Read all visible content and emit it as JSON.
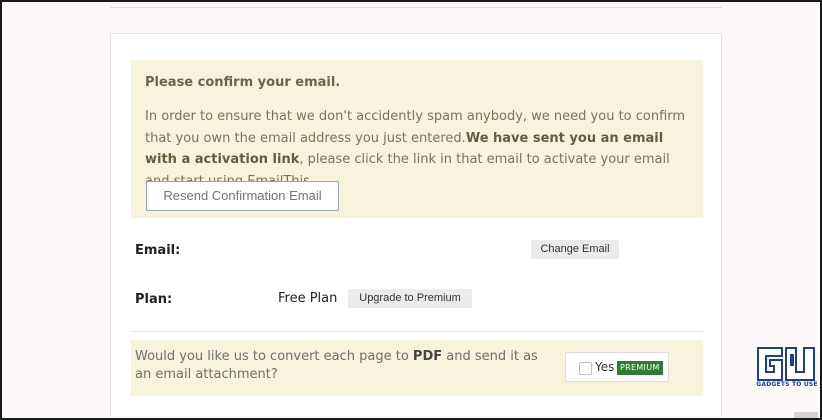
{
  "notice": {
    "title": "Please confirm your email.",
    "body_start": "In order to ensure that we don't accidently spam anybody, we need you to confirm that you own the email address you just entered.",
    "body_bold": "We have sent you an email with a activation link",
    "body_end": ", please click the link in that email to activate your email and start using EmailThis.",
    "resend_label": "Resend Confirmation Email"
  },
  "email": {
    "label": "Email:",
    "value": "",
    "change_label": "Change Email"
  },
  "plan": {
    "label": "Plan:",
    "value": "Free Plan",
    "upgrade_label": "Upgrade to Premium"
  },
  "pdf_option": {
    "text_start": "Would you like us to convert each page to ",
    "text_bold": "PDF",
    "text_end": " and send it as an email attachment?",
    "checkbox_label": "Yes",
    "checked": false,
    "badge": "PREMIUM"
  },
  "watermark": {
    "logo_text": "GU",
    "caption": "GADGETS TO USE"
  },
  "colors": {
    "notice_bg": "#f7f3dc",
    "premium_badge": "#2e7d32",
    "watermark_blue": "#1c3f8f"
  }
}
